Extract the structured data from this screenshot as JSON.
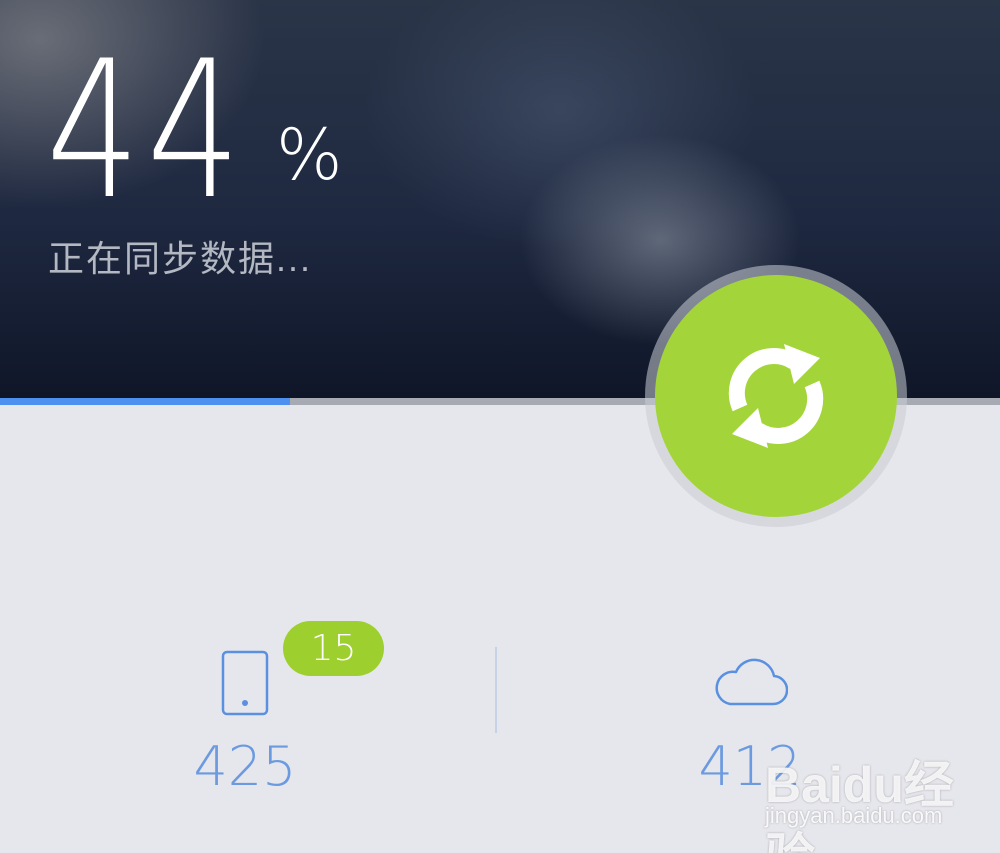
{
  "sync": {
    "percent": "44",
    "percent_sign": "%",
    "progress": 0.29,
    "status": "正在同步数据..."
  },
  "stats": {
    "local_count": "425",
    "local_badge": "15",
    "cloud_count": "412"
  },
  "icons": {
    "sync": "refresh-arrows-icon",
    "local": "phone-icon",
    "cloud": "cloud-icon"
  },
  "colors": {
    "accent_green": "#a3d53a",
    "progress_blue": "#4d90f0",
    "number_blue": "#6b9ae0"
  },
  "watermark": {
    "brand": "Baidu经验",
    "url": "jingyan.baidu.com"
  }
}
